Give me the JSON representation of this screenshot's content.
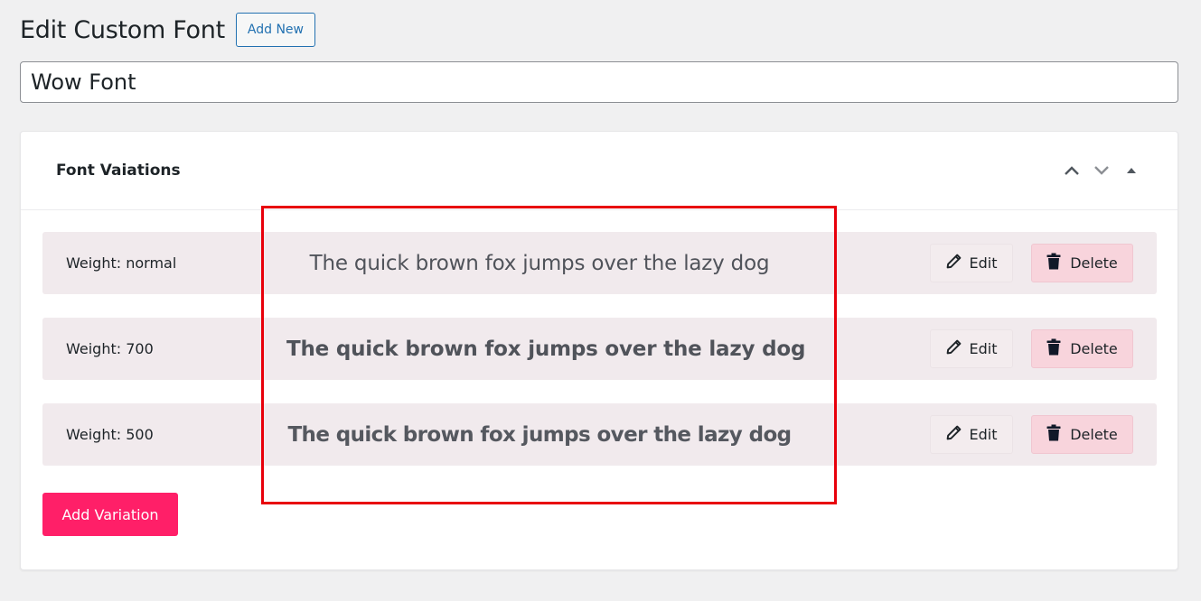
{
  "header": {
    "title": "Edit Custom Font",
    "add_new_label": "Add New"
  },
  "font_name_input": {
    "value": "Wow Font",
    "placeholder": ""
  },
  "panel": {
    "title": "Font Vaiations",
    "controls": {
      "move_up_icon": "chevron-up-icon",
      "move_down_icon": "chevron-down-icon",
      "toggle_icon": "triangle-up-icon"
    },
    "variations": [
      {
        "weight_label": "Weight: normal",
        "weight": "normal",
        "preview_text": "The quick brown fox jumps over the lazy dog",
        "edit_label": "Edit",
        "delete_label": "Delete"
      },
      {
        "weight_label": "Weight: 700",
        "weight": "700",
        "preview_text": "The quick brown fox jumps over the lazy dog",
        "edit_label": "Edit",
        "delete_label": "Delete"
      },
      {
        "weight_label": "Weight: 500",
        "weight": "500",
        "preview_text": "The quick brown fox jumps over the lazy dog",
        "edit_label": "Edit",
        "delete_label": "Delete"
      }
    ],
    "add_variation_label": "Add Variation"
  },
  "colors": {
    "accent_pink": "#ff1f68",
    "link_blue": "#2271b1",
    "row_background": "#f1eaed",
    "delete_background": "#f8d4dc",
    "highlight_red": "#e8000b"
  }
}
